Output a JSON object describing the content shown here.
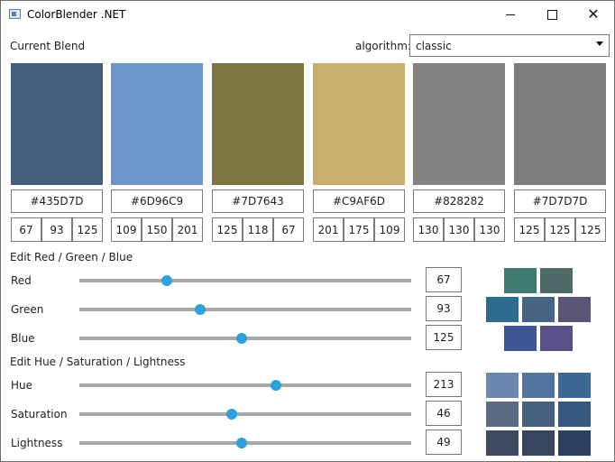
{
  "window": {
    "title": "ColorBlender .NET"
  },
  "labels": {
    "current_blend": "Current Blend",
    "algorithm": "algorithm:",
    "edit_rgb": "Edit Red / Green / Blue",
    "edit_hsl": "Edit Hue / Saturation / Lightness"
  },
  "algorithm": {
    "selected": "classic"
  },
  "swatches": [
    {
      "hex": "#435D7D",
      "color": "#435D7D",
      "r": "67",
      "g": "93",
      "b": "125"
    },
    {
      "hex": "#6D96C9",
      "color": "#6D96C9",
      "r": "109",
      "g": "150",
      "b": "201"
    },
    {
      "hex": "#7D7643",
      "color": "#7D7643",
      "r": "125",
      "g": "118",
      "b": "67"
    },
    {
      "hex": "#C9AF6D",
      "color": "#C9AF6D",
      "r": "201",
      "g": "175",
      "b": "109"
    },
    {
      "hex": "#828282",
      "color": "#828282",
      "r": "130",
      "g": "130",
      "b": "130"
    },
    {
      "hex": "#7D7D7D",
      "color": "#7D7D7D",
      "r": "125",
      "g": "125",
      "b": "125"
    }
  ],
  "rgb_sliders": [
    {
      "label": "Red",
      "value": "67",
      "fraction": 0.263
    },
    {
      "label": "Green",
      "value": "93",
      "fraction": 0.365
    },
    {
      "label": "Blue",
      "value": "125",
      "fraction": 0.49
    }
  ],
  "hsl_sliders": [
    {
      "label": "Hue",
      "value": "213",
      "fraction": 0.592
    },
    {
      "label": "Saturation",
      "value": "46",
      "fraction": 0.46
    },
    {
      "label": "Lightness",
      "value": "49",
      "fraction": 0.49
    }
  ],
  "rgb_variations": [
    "#3f7a73",
    "#4f6a69",
    "#2f6b8f",
    "#456583",
    "#5a5577",
    "#3e5596",
    "#5a4f8a"
  ],
  "hsl_variations": [
    "#6a87ad",
    "#52759f",
    "#3e6797",
    "#5c6a82",
    "#47607f",
    "#38577f",
    "#3e4b5e",
    "#35465f",
    "#2c3f5f"
  ],
  "colors": {
    "slider_thumb": "#2ea0dc",
    "slider_track": "#a8a8a8",
    "border": "#7a7a7a"
  }
}
